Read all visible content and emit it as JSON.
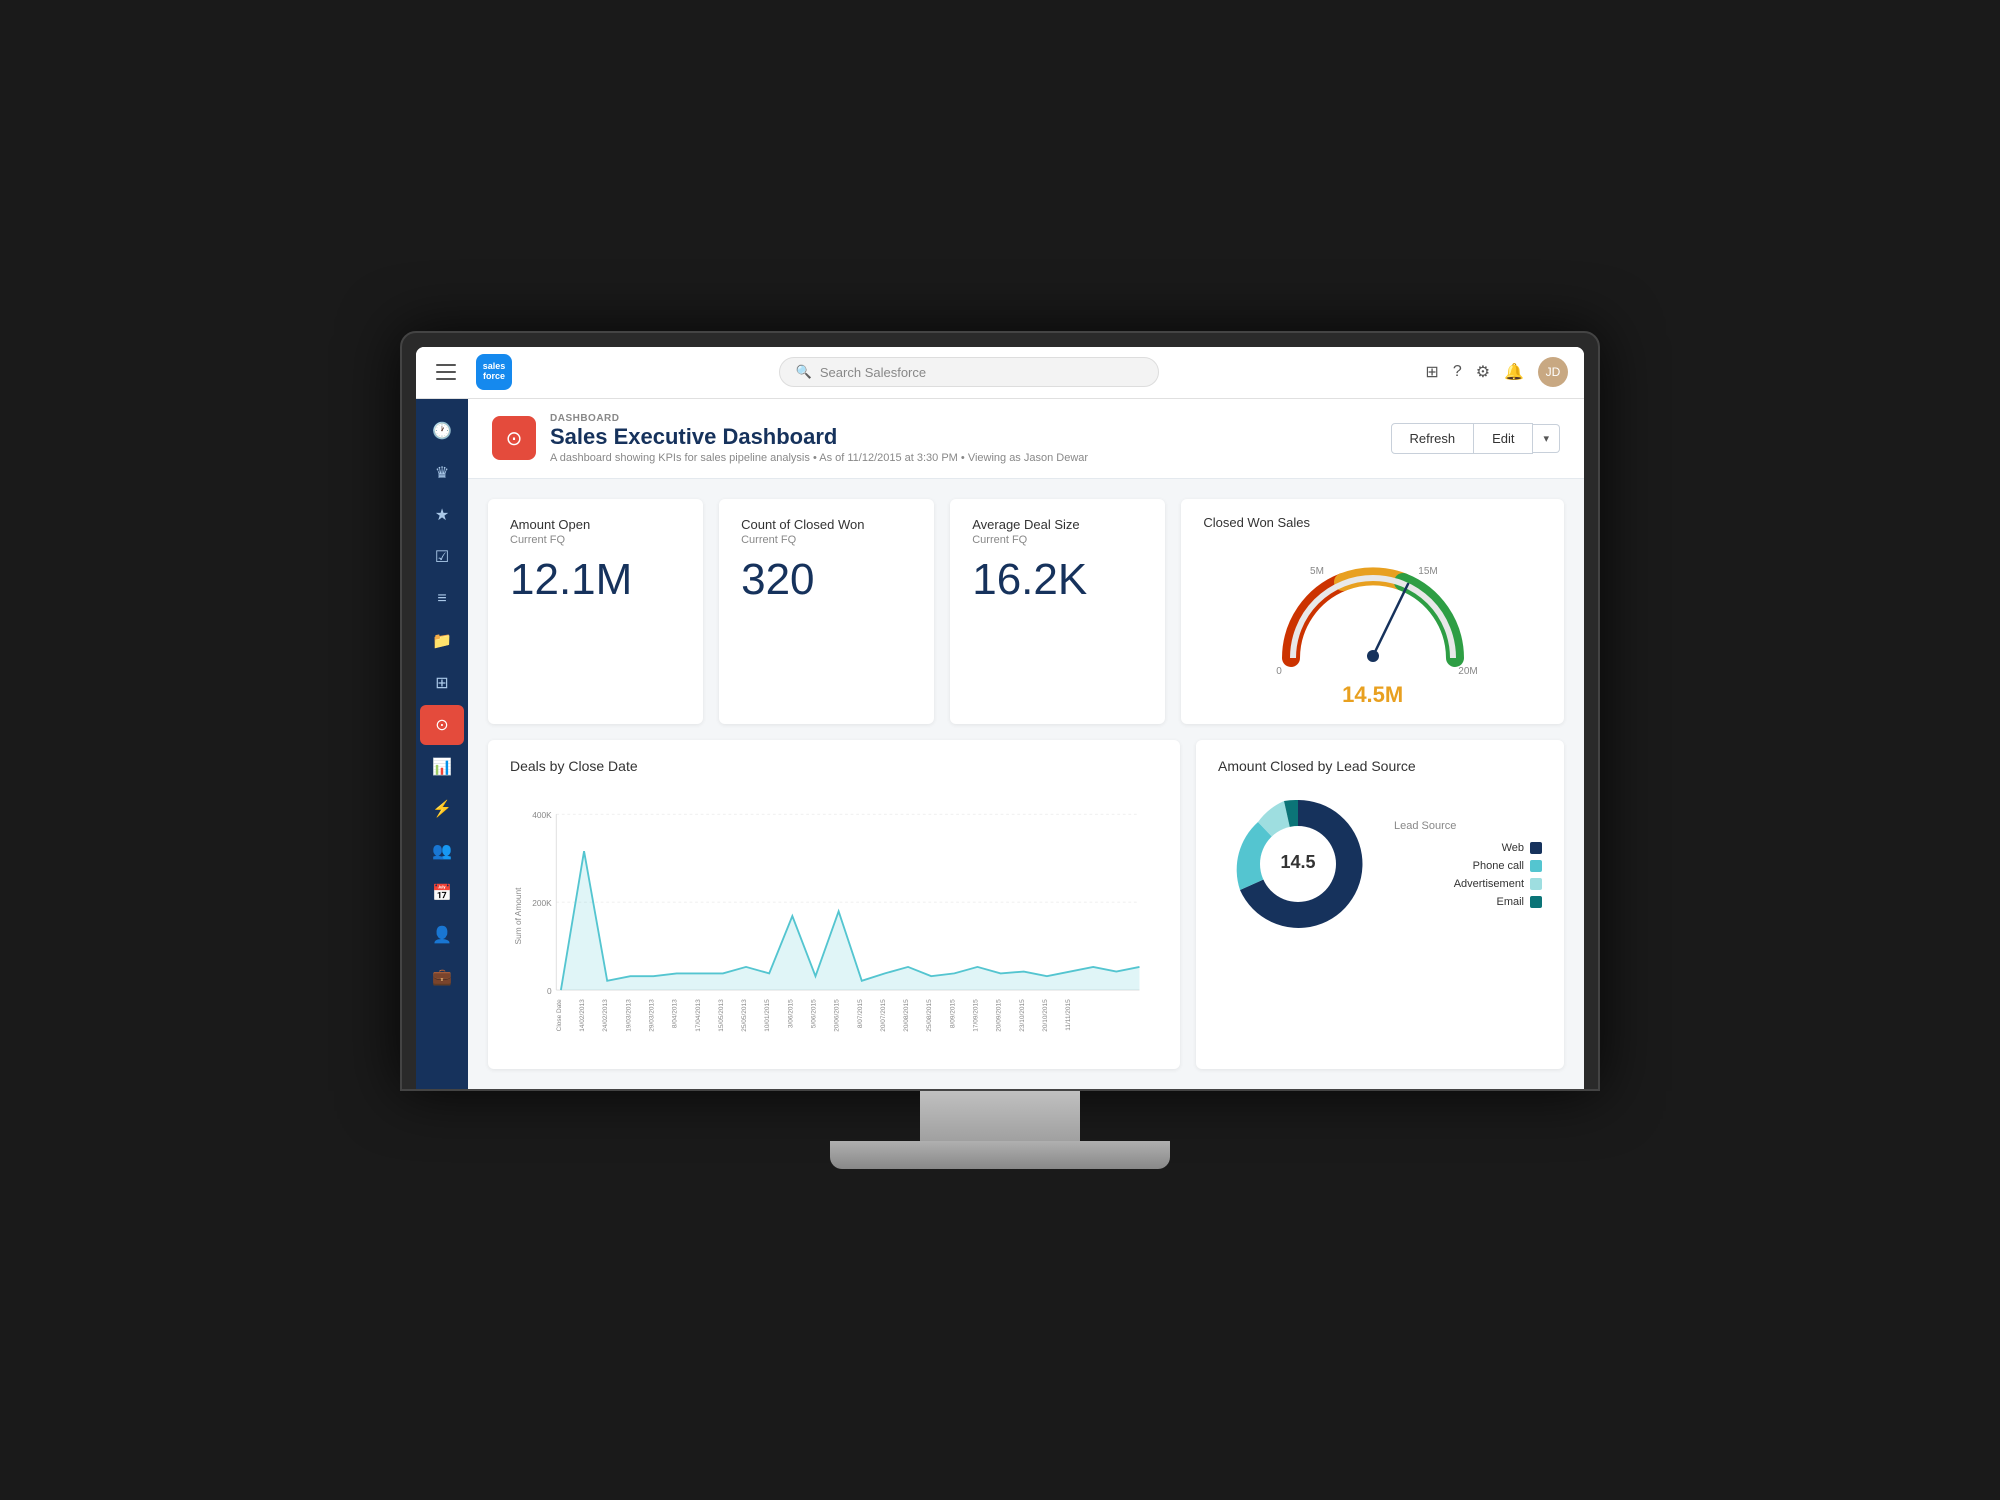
{
  "app": {
    "title": "Salesforce",
    "search_placeholder": "Search Salesforce"
  },
  "nav": {
    "logo_text": "salesforce",
    "search_placeholder": "Search Salesforce",
    "icons": [
      "apps-icon",
      "help-icon",
      "settings-icon",
      "bell-icon",
      "avatar-icon"
    ]
  },
  "sidebar": {
    "items": [
      {
        "id": "clock",
        "icon": "🕐",
        "active": false
      },
      {
        "id": "crown",
        "icon": "♛",
        "active": false
      },
      {
        "id": "star",
        "icon": "★",
        "active": false
      },
      {
        "id": "checkbox",
        "icon": "☑",
        "active": false
      },
      {
        "id": "list",
        "icon": "≡",
        "active": false
      },
      {
        "id": "folder",
        "icon": "📁",
        "active": false
      },
      {
        "id": "grid",
        "icon": "⊞",
        "active": false
      },
      {
        "id": "dashboard",
        "icon": "⊙",
        "active": true
      },
      {
        "id": "chart",
        "icon": "📊",
        "active": false
      },
      {
        "id": "pulse",
        "icon": "⚡",
        "active": false
      },
      {
        "id": "people",
        "icon": "👥",
        "active": false
      },
      {
        "id": "calendar",
        "icon": "📅",
        "active": false
      },
      {
        "id": "users2",
        "icon": "👤",
        "active": false
      },
      {
        "id": "briefcase",
        "icon": "💼",
        "active": false
      }
    ]
  },
  "dashboard": {
    "breadcrumb": "DASHBOARD",
    "title": "Sales Executive Dashboard",
    "subtitle": "A dashboard showing KPIs for sales pipeline analysis",
    "meta": "• As of 11/12/2015 at 3:30 PM • Viewing as Jason Dewar",
    "refresh_label": "Refresh",
    "edit_label": "Edit"
  },
  "kpis": [
    {
      "title": "Amount Open",
      "subtitle": "Current FQ",
      "value": "12.1M"
    },
    {
      "title": "Count of Closed Won",
      "subtitle": "Current FQ",
      "value": "320"
    },
    {
      "title": "Average Deal Size",
      "subtitle": "Current FQ",
      "value": "16.2K"
    }
  ],
  "gauge": {
    "title": "Closed Won Sales",
    "value": "14.5M",
    "min": "0",
    "max": "20M",
    "mark5": "5M",
    "mark15": "15M"
  },
  "line_chart": {
    "title": "Deals by Close Date",
    "y_label": "Sum of Amount",
    "y_marks": [
      "400K",
      "200K",
      "0"
    ],
    "x_labels": [
      "Close Date",
      "14/02/2013",
      "24/02/2013",
      "19/03/2013",
      "29/03/2013",
      "8/04/2013",
      "17/04/2013",
      "15/05/2013",
      "25/05/2013",
      "10/01/2015",
      "3/06/2015",
      "5/06/2015",
      "20/06/2015",
      "8/07/2015",
      "20/07/2015",
      "20/08/2015",
      "25/08/2015",
      "8/09/2015",
      "17/09/2015",
      "20/09/2015",
      "23/10/2015",
      "20/10/2015",
      "11/11/2015"
    ]
  },
  "donut": {
    "title": "Amount Closed by Lead Source",
    "center_value": "14.5",
    "legend_title": "Lead Source",
    "items": [
      {
        "label": "Web",
        "color": "#16325c"
      },
      {
        "label": "Phone call",
        "color": "#54c5d0"
      },
      {
        "label": "Advertisement",
        "color": "#9edee0"
      },
      {
        "label": "Email",
        "color": "#0b7477"
      }
    ]
  }
}
